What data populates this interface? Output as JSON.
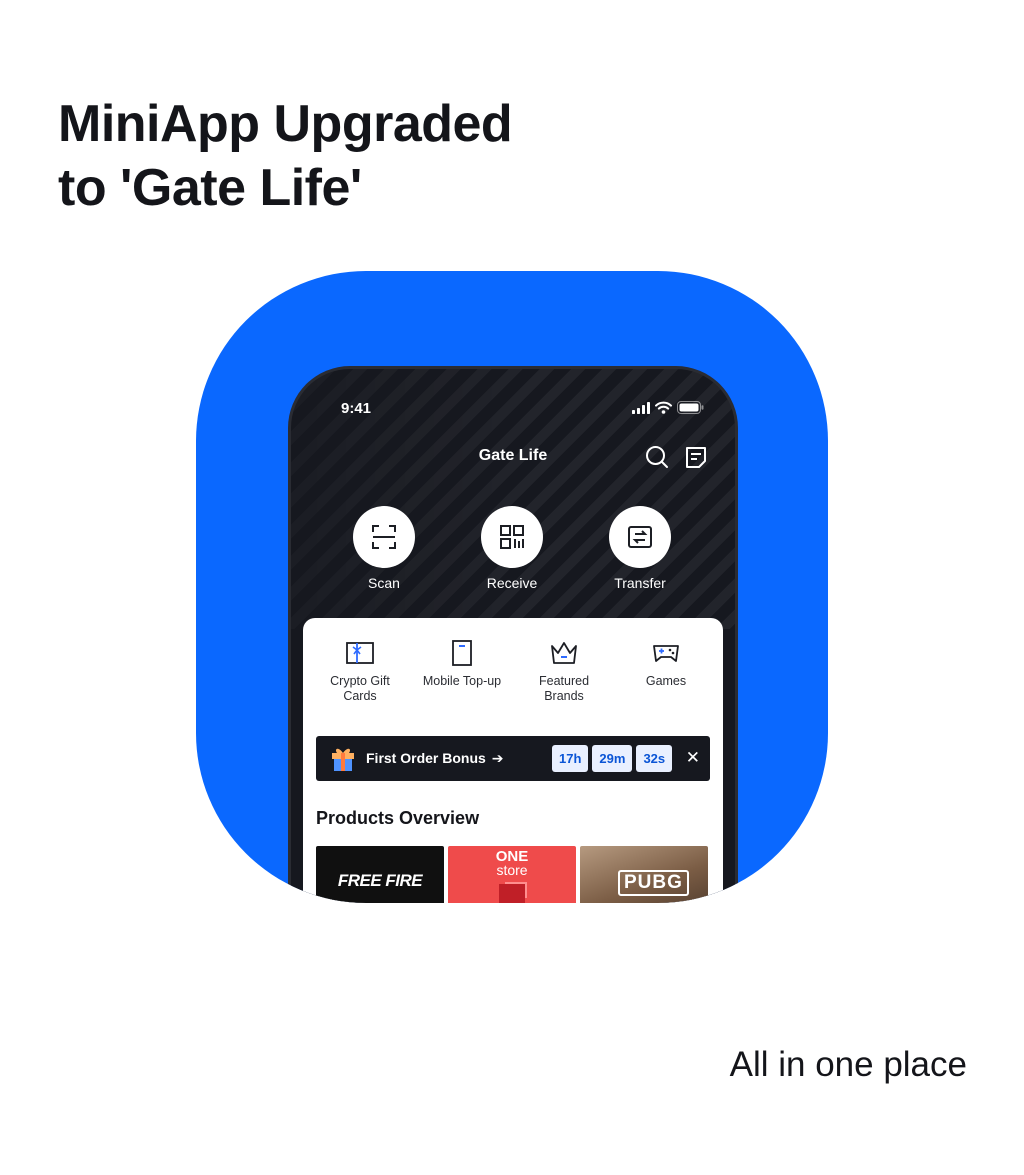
{
  "headline": {
    "line1": "MiniApp Upgraded",
    "line2": "to 'Gate Life'"
  },
  "tagline": "All in one place",
  "colors": {
    "brand_blue": "#0a68ff",
    "dark_bg": "#16181f",
    "accent_blue": "#2f6bff",
    "chip_text": "#0a55d6"
  },
  "status_bar": {
    "time": "9:41",
    "icons": [
      "signal-icon",
      "wifi-icon",
      "battery-icon"
    ]
  },
  "header": {
    "title": "Gate Life",
    "actions": [
      "search-icon",
      "orders-icon"
    ]
  },
  "quick_actions": [
    {
      "label": "Scan",
      "icon": "scan-icon"
    },
    {
      "label": "Receive",
      "icon": "qr-code-icon"
    },
    {
      "label": "Transfer",
      "icon": "transfer-icon"
    }
  ],
  "categories": [
    {
      "line1": "Crypto Gift",
      "line2": "Cards",
      "icon": "gift-card-icon"
    },
    {
      "line1": "Mobile Top-up",
      "line2": "",
      "icon": "mobile-phone-icon"
    },
    {
      "line1": "Featured",
      "line2": "Brands",
      "icon": "crown-icon"
    },
    {
      "line1": "Games",
      "line2": "",
      "icon": "gamepad-icon"
    }
  ],
  "bonus_banner": {
    "text": "First Order Bonus",
    "arrow": "➔",
    "timer": {
      "hours": "17h",
      "minutes": "29m",
      "seconds": "32s"
    },
    "close": "✕"
  },
  "products": {
    "title": "Products Overview",
    "items": [
      {
        "name": "FREE FIRE"
      },
      {
        "name_line1": "ONE",
        "name_line2": "store"
      },
      {
        "name": "PUBG"
      }
    ]
  }
}
